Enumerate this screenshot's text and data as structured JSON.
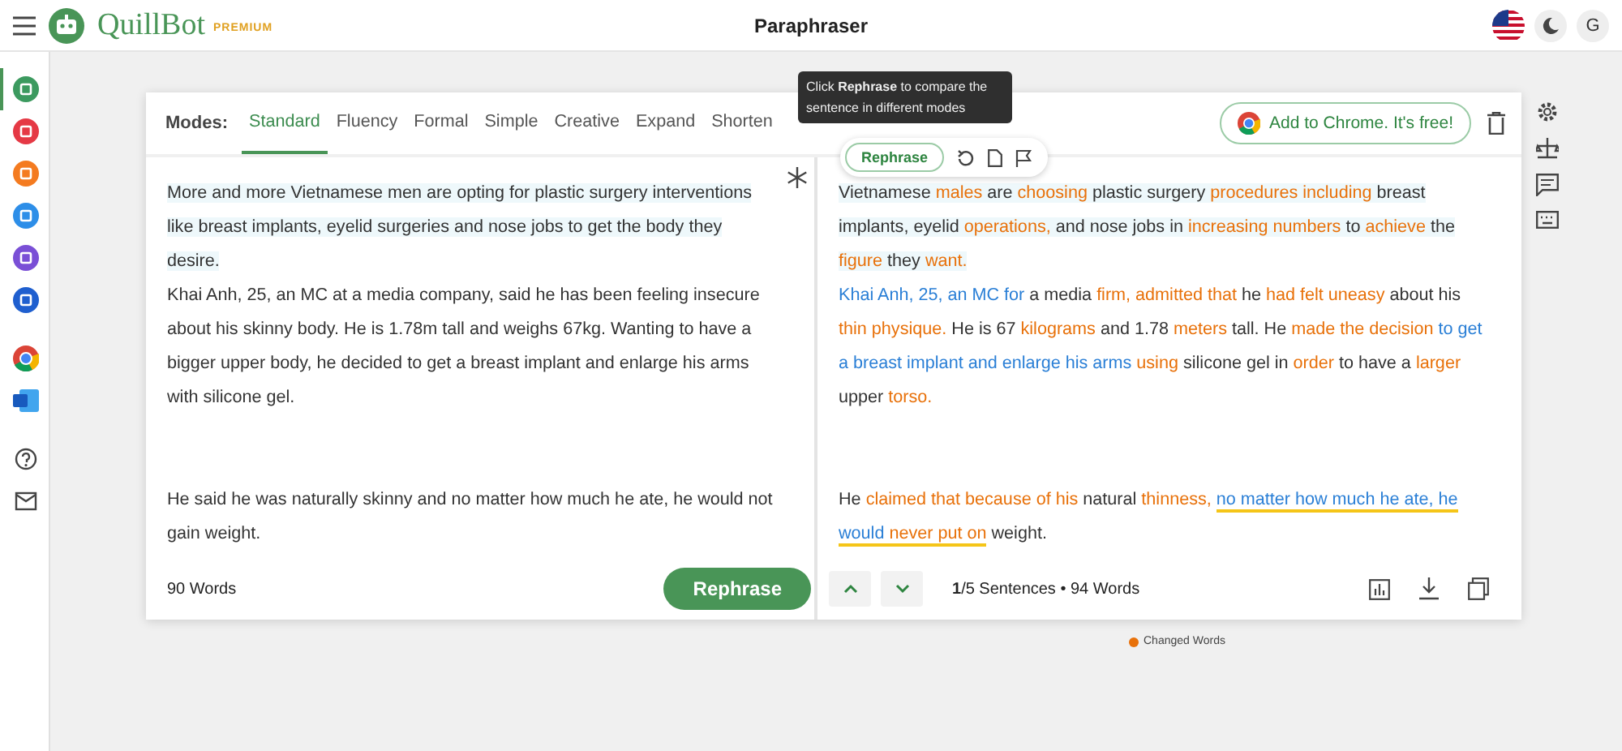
{
  "top_bar": {
    "brand": "QuillBot",
    "badge": "PREMIUM",
    "title": "Paraphraser",
    "avatar": "G"
  },
  "sidebar": {
    "items": [
      {
        "kind": "summarize",
        "selected": true
      },
      {
        "kind": "grammar",
        "selected": false
      },
      {
        "kind": "plagiarism",
        "selected": false
      },
      {
        "kind": "cowriter",
        "selected": false
      },
      {
        "kind": "summarizer",
        "selected": false
      },
      {
        "kind": "citation",
        "selected": false
      },
      {
        "kind": "chrome",
        "selected": false
      },
      {
        "kind": "word",
        "selected": false
      },
      {
        "kind": "help",
        "selected": false
      },
      {
        "kind": "mail",
        "selected": false
      }
    ]
  },
  "modes": {
    "label": "Modes:",
    "tabs": [
      {
        "label": "Standard",
        "selected": true
      },
      {
        "label": "Fluency",
        "selected": false
      },
      {
        "label": "Formal",
        "selected": false
      },
      {
        "label": "Simple",
        "selected": false
      },
      {
        "label": "Creative",
        "selected": false
      },
      {
        "label": "Expand",
        "selected": false
      },
      {
        "label": "Shorten",
        "selected": false
      }
    ]
  },
  "tooltip": "Click **Rephrase** to compare the sentence in different modes",
  "chrome_button": "Add to Chrome. It's free!",
  "sentence_popup": {
    "button": "Rephrase"
  },
  "input": {
    "paragraphs": [
      [
        {
          "text": "More and more Vietnamese men are opting for plastic surgery interventions like breast implants, eyelid surgeries and nose jobs to get the body they desire.",
          "selected": true
        }
      ],
      [
        {
          "text": "Khai Anh, 25, an MC at a media company, said he has been feeling insecure about his skinny body.",
          "selected": false
        },
        {
          "text": " He is 1.78m tall and weighs 67kg.",
          "selected": false
        },
        {
          "text": " Wanting to have a bigger upper body, he decided to get a breast implant and enlarge his arms with silicone gel.",
          "selected": false
        }
      ],
      [
        {
          "text": "He said he was naturally skinny and no matter how much he ate, he would not gain weight.",
          "selected": false
        }
      ]
    ],
    "word_count": "90 Words",
    "rephrase_button": "Rephrase"
  },
  "output": {
    "paragraphs": [
      [
        {
          "selected": true,
          "segments": [
            {
              "text": "Vietnamese ",
              "kind": "plain",
              "underline": false
            },
            {
              "text": "males",
              "kind": "changed",
              "underline": false
            },
            {
              "text": " are ",
              "kind": "plain",
              "underline": false
            },
            {
              "text": "choosing",
              "kind": "changed",
              "underline": false
            },
            {
              "text": " plastic surgery ",
              "kind": "plain",
              "underline": false
            },
            {
              "text": "procedures including",
              "kind": "changed",
              "underline": false
            },
            {
              "text": " breast implants, eyelid ",
              "kind": "plain",
              "underline": false
            },
            {
              "text": "operations,",
              "kind": "changed",
              "underline": false
            },
            {
              "text": " and nose jobs in ",
              "kind": "plain",
              "underline": false
            },
            {
              "text": "increasing numbers",
              "kind": "changed",
              "underline": false
            },
            {
              "text": " to ",
              "kind": "plain",
              "underline": false
            },
            {
              "text": "achieve",
              "kind": "changed",
              "underline": false
            },
            {
              "text": " the ",
              "kind": "plain",
              "underline": false
            },
            {
              "text": "figure",
              "kind": "changed",
              "underline": false
            },
            {
              "text": " they ",
              "kind": "plain",
              "underline": false
            },
            {
              "text": "want.",
              "kind": "changed",
              "underline": false
            }
          ]
        }
      ],
      [
        {
          "selected": false,
          "segments": [
            {
              "text": "Khai Anh, 25, an MC for",
              "kind": "structural",
              "underline": false
            },
            {
              "text": " a media ",
              "kind": "plain",
              "underline": false
            },
            {
              "text": "firm, admitted that",
              "kind": "changed",
              "underline": false
            },
            {
              "text": " he ",
              "kind": "plain",
              "underline": false
            },
            {
              "text": "had felt uneasy",
              "kind": "changed",
              "underline": false
            },
            {
              "text": " about his ",
              "kind": "plain",
              "underline": false
            },
            {
              "text": "thin physique.",
              "kind": "changed",
              "underline": false
            }
          ]
        },
        {
          "selected": false,
          "segments": [
            {
              "text": " He is 67 ",
              "kind": "plain",
              "underline": false
            },
            {
              "text": "kilograms",
              "kind": "changed",
              "underline": false
            },
            {
              "text": " and 1.78 ",
              "kind": "plain",
              "underline": false
            },
            {
              "text": "meters",
              "kind": "changed",
              "underline": false
            },
            {
              "text": " tall.",
              "kind": "plain",
              "underline": false
            }
          ]
        },
        {
          "selected": false,
          "segments": [
            {
              "text": " He ",
              "kind": "plain",
              "underline": false
            },
            {
              "text": "made the decision",
              "kind": "changed",
              "underline": false
            },
            {
              "text": " to get a breast implant and enlarge his arms",
              "kind": "structural",
              "underline": false
            },
            {
              "text": " using",
              "kind": "changed",
              "underline": false
            },
            {
              "text": " silicone gel in ",
              "kind": "plain",
              "underline": false
            },
            {
              "text": "order",
              "kind": "changed",
              "underline": false
            },
            {
              "text": " to have a ",
              "kind": "plain",
              "underline": false
            },
            {
              "text": "larger",
              "kind": "changed",
              "underline": false
            },
            {
              "text": " upper ",
              "kind": "plain",
              "underline": false
            },
            {
              "text": "torso.",
              "kind": "changed",
              "underline": false
            }
          ]
        }
      ],
      [
        {
          "selected": false,
          "segments": [
            {
              "text": "He ",
              "kind": "plain",
              "underline": false
            },
            {
              "text": "claimed that because of his",
              "kind": "changed",
              "underline": false
            },
            {
              "text": " natural ",
              "kind": "plain",
              "underline": false
            },
            {
              "text": "thinness, ",
              "kind": "changed",
              "underline": false
            },
            {
              "text": "no matter how much he ate, he would",
              "kind": "structural",
              "underline": true
            },
            {
              "text": " never put on",
              "kind": "changed",
              "underline": true
            },
            {
              "text": " weight.",
              "kind": "plain",
              "underline": false
            }
          ]
        }
      ]
    ],
    "status": "**1**/5 Sentences • 94 Words"
  },
  "legend": [
    {
      "label": "Changed Words",
      "color": "#e8710a"
    }
  ]
}
